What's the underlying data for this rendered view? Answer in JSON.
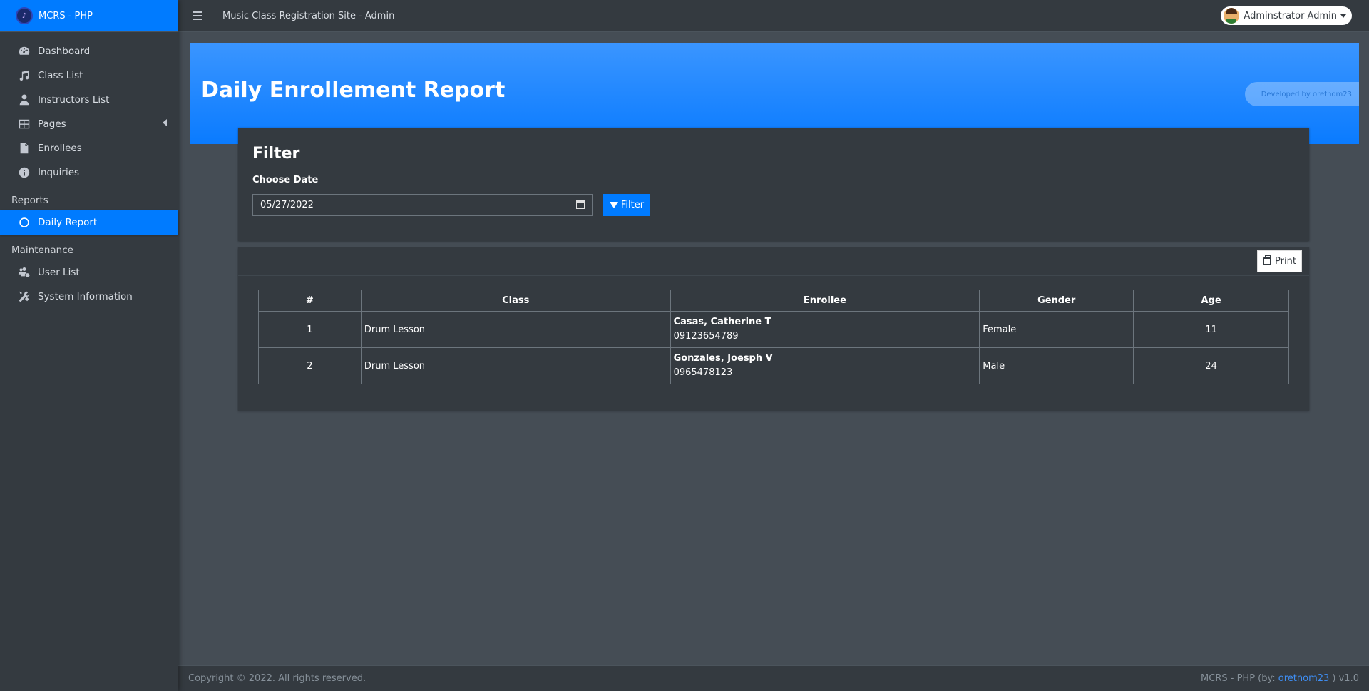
{
  "brand": {
    "name": "MCRS - PHP"
  },
  "topbar": {
    "title": "Music Class Registration Site - Admin",
    "user_name": "Adminstrator Admin"
  },
  "sidebar": {
    "items": [
      {
        "label": "Dashboard",
        "icon": "dashboard-icon"
      },
      {
        "label": "Class List",
        "icon": "music-icon"
      },
      {
        "label": "Instructors List",
        "icon": "user-tie-icon"
      },
      {
        "label": "Pages",
        "icon": "table-icon"
      },
      {
        "label": "Enrollees",
        "icon": "file-icon"
      },
      {
        "label": "Inquiries",
        "icon": "info-icon"
      }
    ],
    "reports_header": "Reports",
    "daily_report": "Daily Report",
    "maintenance_header": "Maintenance",
    "maintenance_items": [
      {
        "label": "User List",
        "icon": "users-cog-icon"
      },
      {
        "label": "System Information",
        "icon": "tools-icon"
      }
    ]
  },
  "page": {
    "title": "Daily Enrollement Report",
    "developer_badge": "Developed by oretnom23"
  },
  "filter": {
    "title": "Filter",
    "date_label": "Choose Date",
    "date_value": "05/27/2022",
    "button_label": "Filter"
  },
  "report": {
    "print_label": "Print",
    "columns": [
      "#",
      "Class",
      "Enrollee",
      "Gender",
      "Age"
    ],
    "rows": [
      {
        "num": "1",
        "class": "Drum Lesson",
        "name": "Casas, Catherine T",
        "phone": "09123654789",
        "gender": "Female",
        "age": "11"
      },
      {
        "num": "2",
        "class": "Drum Lesson",
        "name": "Gonzales, Joesph V",
        "phone": "0965478123",
        "gender": "Male",
        "age": "24"
      }
    ]
  },
  "footer": {
    "copyright": "Copyright © 2022. All rights reserved.",
    "credit_prefix": "MCRS - PHP (by: ",
    "credit_link": "oretnom23",
    "credit_suffix": " ) v1.0"
  },
  "colors": {
    "accent": "#007bff",
    "sidebar_bg": "#343a40",
    "content_bg": "#454d55"
  }
}
